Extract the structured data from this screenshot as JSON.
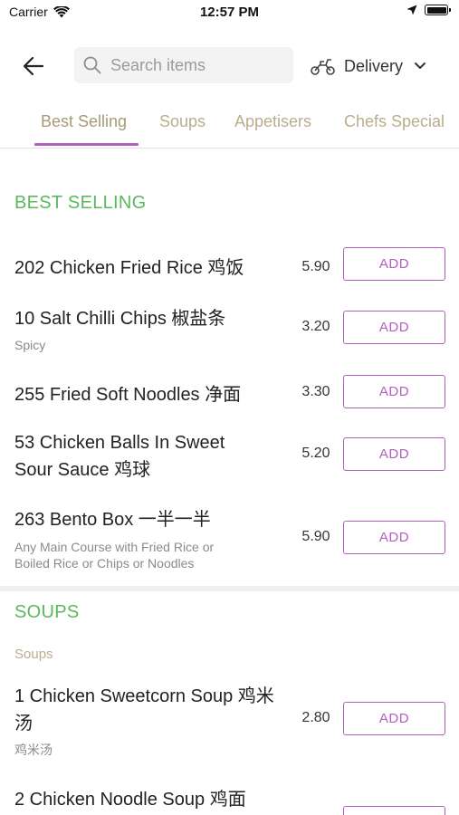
{
  "status_bar": {
    "carrier": "Carrier",
    "time": "12:57 PM"
  },
  "header": {
    "search_placeholder": "Search items",
    "delivery_label": "Delivery"
  },
  "tabs": [
    {
      "label": "Best Selling",
      "active": true
    },
    {
      "label": "Soups",
      "active": false
    },
    {
      "label": "Appetisers",
      "active": false
    },
    {
      "label": "Chefs Special",
      "active": false
    }
  ],
  "sections": [
    {
      "title": "BEST SELLING",
      "items": [
        {
          "name": "202 Chicken Fried Rice 鸡饭",
          "desc": "",
          "price": "5.90",
          "button": "ADD"
        },
        {
          "name": "10 Salt Chilli Chips 椒盐条",
          "desc": "Spicy",
          "price": "3.20",
          "button": "ADD"
        },
        {
          "name": "255 Fried Soft Noodles 净面",
          "desc": "",
          "price": "3.30",
          "button": "ADD"
        },
        {
          "name": "53 Chicken Balls In Sweet Sour Sauce 鸡球",
          "desc": "",
          "price": "5.20",
          "button": "ADD"
        },
        {
          "name": "263 Bento Box 一半一半",
          "desc": "Any Main Course with Fried Rice or Boiled Rice or Chips or Noodles",
          "price": "5.90",
          "button": "ADD"
        }
      ]
    },
    {
      "title": "SOUPS",
      "subtitle": "Soups",
      "items": [
        {
          "name": "1 Chicken Sweetcorn Soup 鸡米汤",
          "desc": "鸡米汤",
          "price": "2.80",
          "button": "ADD"
        },
        {
          "name": "2 Chicken Noodle Soup 鸡面",
          "desc": "",
          "price": "",
          "button": "ADD"
        }
      ]
    }
  ],
  "colors": {
    "accent": "#b35fc0",
    "section_title": "#5cb85c",
    "tab_text": "#b9ad8c"
  }
}
